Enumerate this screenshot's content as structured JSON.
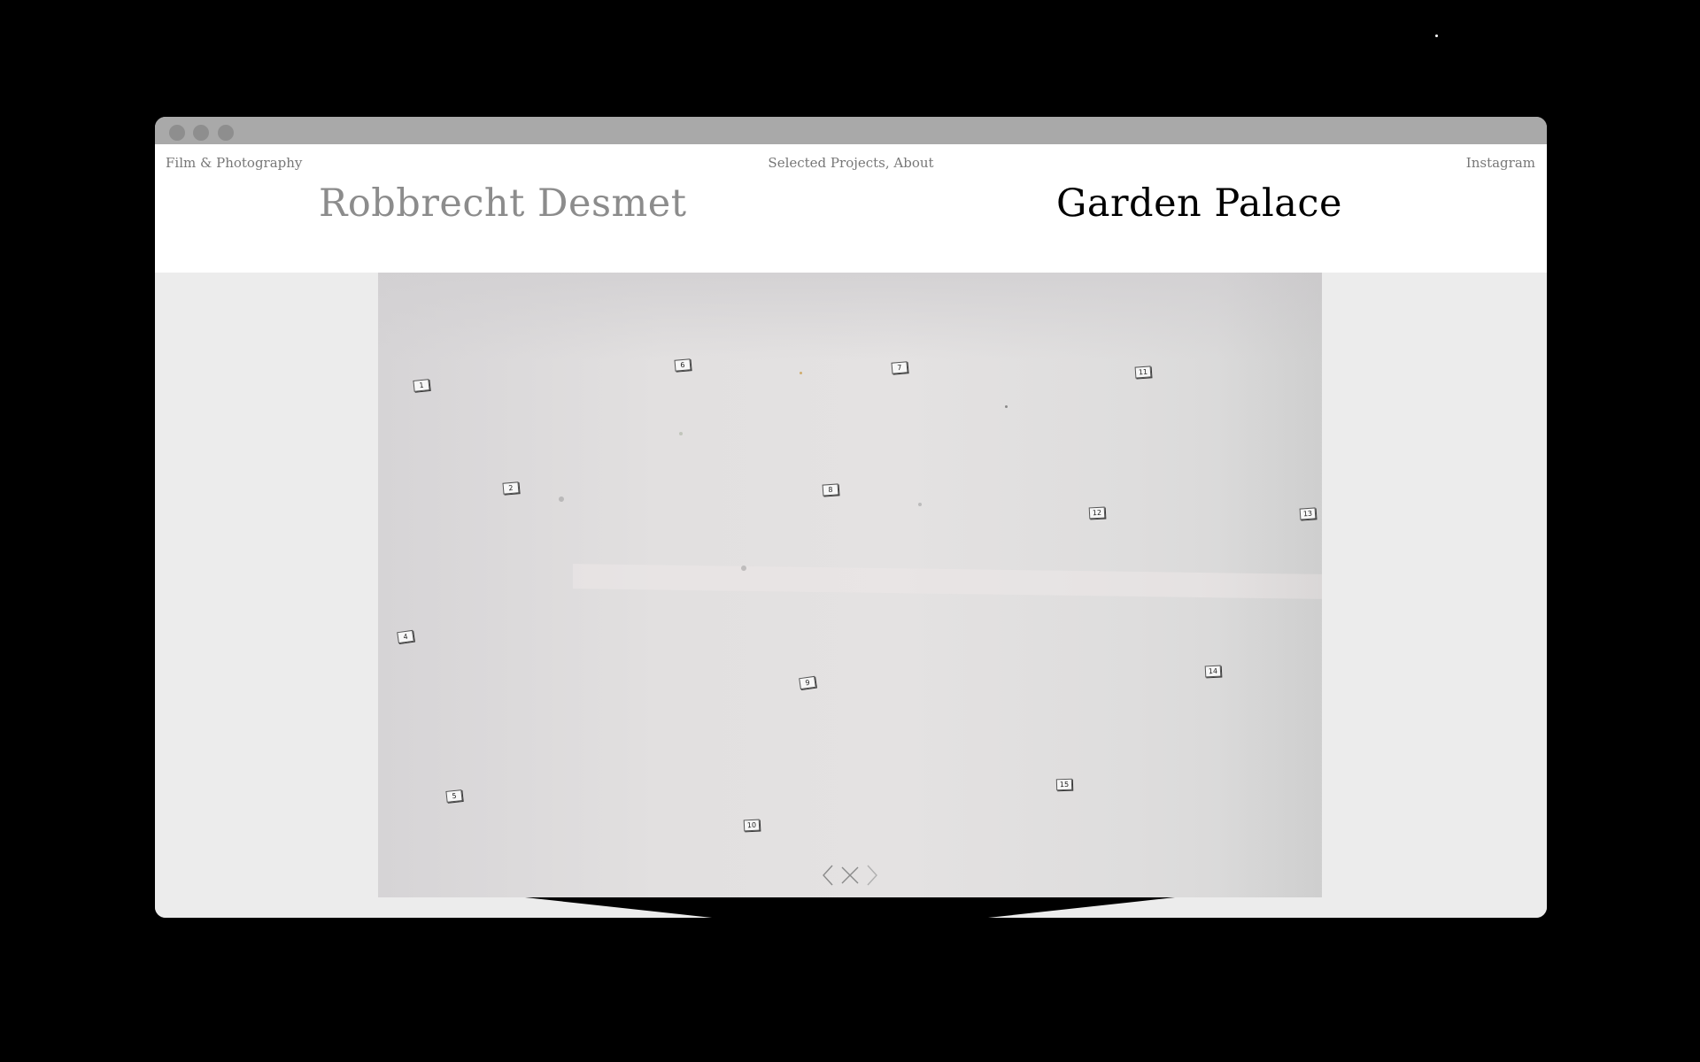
{
  "nav": {
    "left_label": "Film & Photography",
    "center_links": [
      "Selected Projects",
      "About"
    ],
    "center_separator": ", ",
    "right_label": "Instagram"
  },
  "header": {
    "site_name": "Robbrecht Desmet",
    "project_title": "Garden Palace"
  },
  "photo": {
    "markers": [
      "1",
      "2",
      "4",
      "5",
      "6",
      "7",
      "8",
      "9",
      "10",
      "11",
      "12",
      "13",
      "14",
      "15"
    ]
  },
  "viewer": {
    "controls": [
      "previous-icon",
      "close-icon",
      "next-icon"
    ]
  },
  "colors": {
    "background": "#000000",
    "window": "#ececec",
    "titlebar": "#a9a9a9",
    "site_name": "#8c8c8c",
    "project_title": "#000000",
    "nav_text": "#777777"
  }
}
